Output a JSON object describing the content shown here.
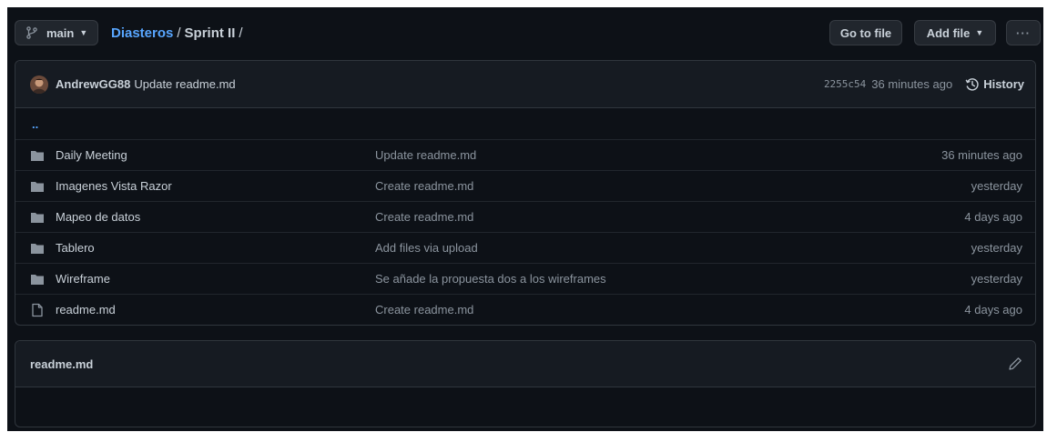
{
  "colors": {
    "background": "#0d1117",
    "header_bg": "#161b22",
    "border": "#30363d",
    "link": "#58a6ff",
    "text": "#c9d1d9",
    "muted": "#8b949e"
  },
  "toolbar": {
    "branch": "main",
    "breadcrumb": {
      "repo": "Diasteros",
      "separator": "/",
      "folder": "Sprint II",
      "trailing": "/"
    },
    "goto_label": "Go to file",
    "addfile_label": "Add file",
    "more_label": "···"
  },
  "commit": {
    "author": "AndrewGG88",
    "message": "Update readme.md",
    "sha": "2255c54",
    "age": "36 minutes ago",
    "history_label": "History"
  },
  "parent_link": "..",
  "files": [
    {
      "type": "folder",
      "icon": "folder-icon",
      "name": "Daily Meeting",
      "message": "Update readme.md",
      "age": "36 minutes ago"
    },
    {
      "type": "folder",
      "icon": "folder-icon",
      "name": "Imagenes Vista Razor",
      "message": "Create readme.md",
      "age": "yesterday"
    },
    {
      "type": "folder",
      "icon": "folder-icon",
      "name": "Mapeo de datos",
      "message": "Create readme.md",
      "age": "4 days ago"
    },
    {
      "type": "folder",
      "icon": "folder-icon",
      "name": "Tablero",
      "message": "Add files via upload",
      "age": "yesterday"
    },
    {
      "type": "folder",
      "icon": "folder-icon",
      "name": "Wireframe",
      "message": "Se añade la propuesta dos a los wireframes",
      "age": "yesterday"
    },
    {
      "type": "file",
      "icon": "file-icon",
      "name": "readme.md",
      "message": "Create readme.md",
      "age": "4 days ago"
    }
  ],
  "readme": {
    "title": "readme.md"
  }
}
